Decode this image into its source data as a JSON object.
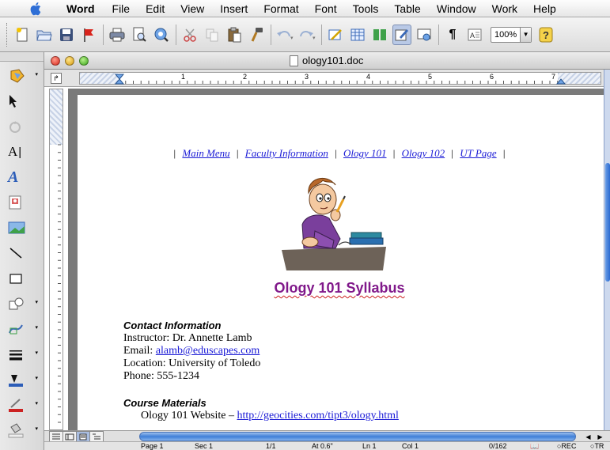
{
  "menubar": {
    "app_name": "Word",
    "items": [
      "File",
      "Edit",
      "View",
      "Insert",
      "Format",
      "Font",
      "Tools",
      "Table",
      "Window",
      "Work",
      "Help"
    ]
  },
  "toolbar": {
    "zoom_value": "100%",
    "icons": [
      "new-document-icon",
      "open-folder-icon",
      "save-icon",
      "flag-icon",
      "print-icon",
      "print-preview-icon",
      "search-web-icon",
      "cut-icon",
      "copy-icon",
      "paste-icon",
      "format-painter-icon",
      "undo-icon",
      "redo-icon",
      "tables-borders-icon",
      "insert-table-icon",
      "columns-icon",
      "drawing-icon",
      "web-view-icon",
      "paragraph-mark-icon",
      "text-box-icon",
      "help-icon"
    ]
  },
  "window": {
    "title": "ology101.doc"
  },
  "document": {
    "nav_links": [
      "Main Menu",
      "Faculty Information",
      "Ology 101",
      "Ology 102",
      "UT Page"
    ],
    "nav_sep": "|",
    "heading": "Ology 101 Syllabus",
    "contact": {
      "title": "Contact Information",
      "instructor": "Instructor: Dr. Annette Lamb",
      "email_label": "Email: ",
      "email_link": "alamb@eduscapes.com",
      "location": "Location: University of Toledo",
      "phone": "Phone: 555-1234"
    },
    "materials": {
      "title": "Course Materials",
      "website_label": "Ology 101 Website – ",
      "website_link": "http://geocities.com/tipt3/ology.html"
    }
  },
  "ruler": {
    "numbers": [
      "1",
      "2",
      "3",
      "4",
      "5",
      "6",
      "7"
    ]
  },
  "statusbar": {
    "page": "Page 1",
    "sec": "Sec 1",
    "pages": "1/1",
    "at": "At 0.6\"",
    "ln": "Ln 1",
    "col": "Col 1",
    "words": "0/162",
    "rec": "REC",
    "trk": "TR"
  },
  "colors": {
    "heading": "#80188a",
    "link": "#1a1ad6",
    "scroll": "#3f7fd8"
  }
}
